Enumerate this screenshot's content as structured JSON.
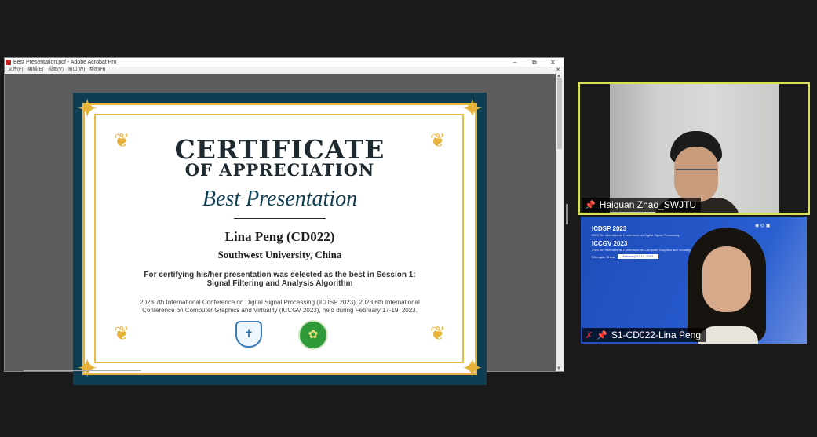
{
  "acrobat": {
    "window_title": "Best Presentation.pdf - Adobe Acrobat Pro",
    "minimize": "–",
    "restore": "⧉",
    "close": "✕",
    "menu": [
      "文件(F)",
      "编辑(E)",
      "视图(V)",
      "窗口(W)",
      "帮助(H)"
    ],
    "doc_close": "✕"
  },
  "certificate": {
    "title_line1": "CERTIFICATE",
    "title_line2": "OF APPRECIATION",
    "award": "Best Presentation",
    "recipient": "Lina Peng (CD022)",
    "affiliation": "Southwest University, China",
    "reason_line1": "For certifying his/her presentation was selected as the best in Session 1:",
    "reason_line2": "Signal Filtering and Analysis Algorithm",
    "conference_line1": "2023 7th International Conference on Digital Signal Processing (ICDSP 2023), 2023 6th International",
    "conference_line2": "Conference on Computer Graphics and Virtuality (ICCGV 2023), held during February 17-19, 2023.",
    "colors": {
      "frame": "#0f3d52",
      "gold": "#e6b23a"
    }
  },
  "participants": [
    {
      "name": "Haiquan Zhao_SWJTU",
      "pin_icon": "pin-icon",
      "active_speaker": true
    },
    {
      "name": "S1-CD022-Lina Peng",
      "pin_icon": "pin-icon",
      "mic_icon": "mic-muted-icon"
    }
  ],
  "background_slide": {
    "icdsp": "ICDSP 2023",
    "icdsp_sub": "2023 7th International Conference on Digital Signal Processing",
    "iccgv": "ICCGV 2023",
    "iccgv_sub": "2023 6th International Conference on Computer Graphics and Virtuality",
    "location": "Chengdu, China",
    "dates": "February 17-19, 2023 (GMT+8)"
  }
}
